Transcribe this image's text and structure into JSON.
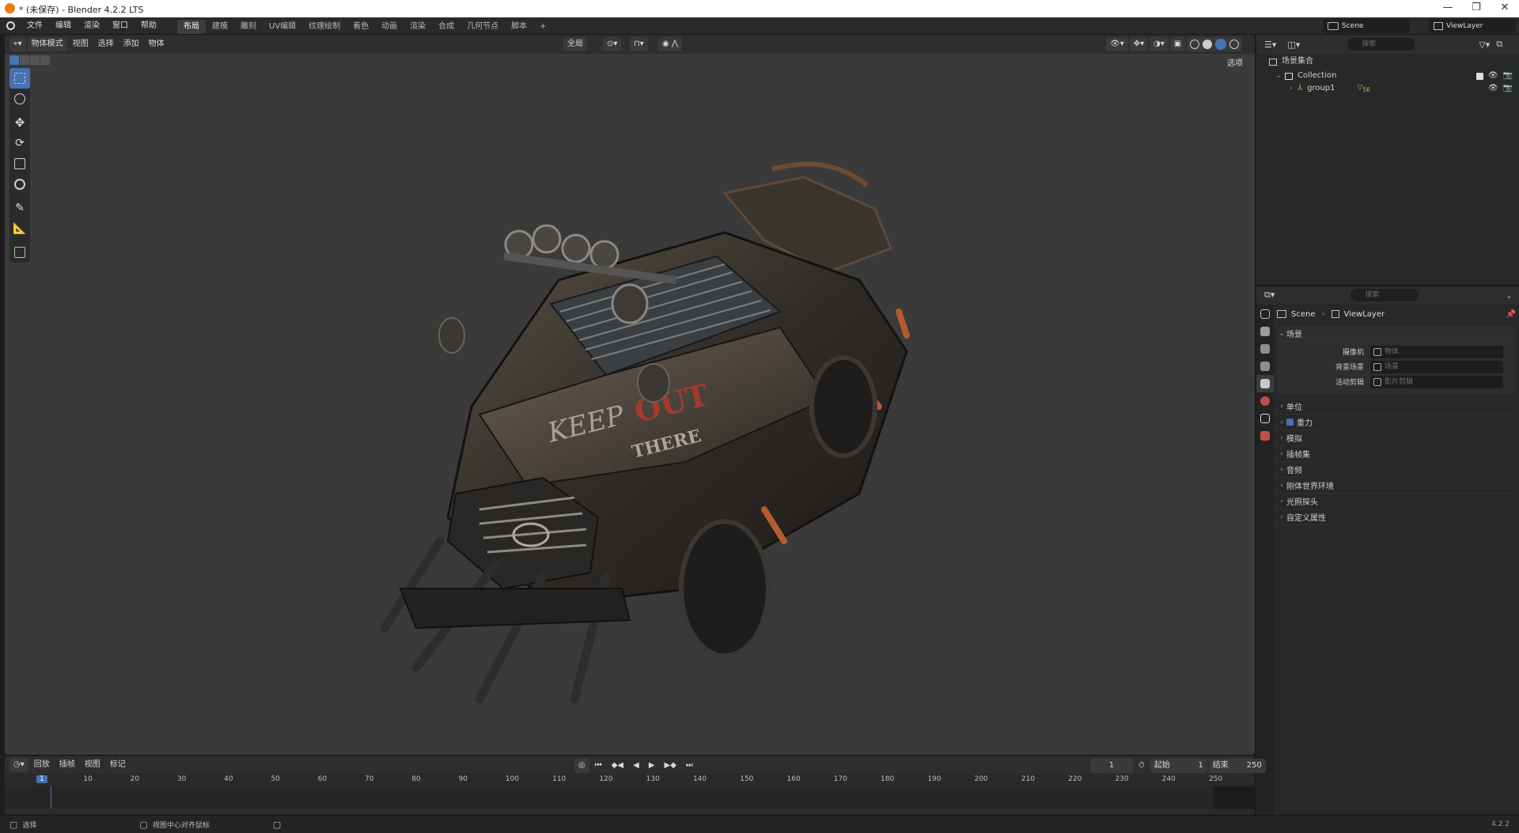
{
  "window": {
    "title": "* (未保存) - Blender 4.2.2 LTS",
    "min": "—",
    "max": "❐",
    "close": "✕"
  },
  "menu": [
    "文件",
    "编辑",
    "渲染",
    "窗口",
    "帮助"
  ],
  "workspaces": [
    "布局",
    "建模",
    "雕刻",
    "UV编辑",
    "纹理绘制",
    "着色",
    "动画",
    "渲染",
    "合成",
    "几何节点",
    "脚本"
  ],
  "workspace_add": "+",
  "top_right": {
    "scene": "Scene",
    "view_layer": "ViewLayer"
  },
  "viewport": {
    "mode": "物体模式",
    "menus": [
      "视图",
      "选择",
      "添加",
      "物体"
    ],
    "transform_orientation": "全局",
    "options": "选项",
    "overlay_text": [
      "KEEP",
      "OUT",
      "THERE"
    ]
  },
  "outliner": {
    "search_placeholder": "搜索",
    "scene_collection": "场景集合",
    "collection": "Collection",
    "object": "group1",
    "object_badge": "56"
  },
  "properties": {
    "search_placeholder": "搜索",
    "breadcrumb_scene": "Scene",
    "breadcrumb_sep": "›",
    "breadcrumb_layer": "ViewLayer",
    "scene_section": "场景",
    "fields": [
      {
        "label": "摄像机",
        "placeholder": "物体"
      },
      {
        "label": "背景场景",
        "placeholder": "场景"
      },
      {
        "label": "活动剪辑",
        "placeholder": "影片剪辑"
      }
    ],
    "sections": [
      "单位",
      "重力",
      "模拟",
      "插帧集",
      "音频",
      "刚体世界环境",
      "光照探头",
      "自定义属性"
    ]
  },
  "timeline": {
    "menus": [
      "回放",
      "插帧",
      "视图",
      "标记"
    ],
    "current_frame": "1",
    "start_label": "起始",
    "start": "1",
    "end_label": "结束",
    "end": "250",
    "ticks": [
      "10",
      "20",
      "30",
      "40",
      "50",
      "60",
      "70",
      "80",
      "90",
      "100",
      "110",
      "120",
      "130",
      "140",
      "150",
      "160",
      "170",
      "180",
      "190",
      "200",
      "210",
      "220",
      "230",
      "240",
      "250"
    ],
    "marker": "1"
  },
  "status": {
    "select": "选择",
    "center_view": "视图中心对齐鼠标",
    "version": "4.2.2"
  },
  "colors": {
    "accent": "#4772b3",
    "blender_orange": "#e87d0d",
    "viewport_bg": "#3a3a3a"
  }
}
